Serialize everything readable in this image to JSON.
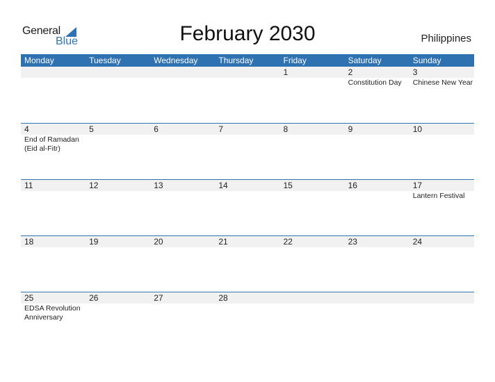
{
  "logo": {
    "word1": "General",
    "word2": "Blue"
  },
  "title": "February 2030",
  "country": "Philippines",
  "colors": {
    "header": "#2e72b2",
    "brand": "#2e74b5",
    "band": "#f1f1f1"
  },
  "weekdays": [
    "Monday",
    "Tuesday",
    "Wednesday",
    "Thursday",
    "Friday",
    "Saturday",
    "Sunday"
  ],
  "weeks": [
    [
      {
        "day": "",
        "event": ""
      },
      {
        "day": "",
        "event": ""
      },
      {
        "day": "",
        "event": ""
      },
      {
        "day": "",
        "event": ""
      },
      {
        "day": "1",
        "event": ""
      },
      {
        "day": "2",
        "event": "Constitution Day"
      },
      {
        "day": "3",
        "event": "Chinese New Year"
      }
    ],
    [
      {
        "day": "4",
        "event": "End of Ramadan (Eid al-Fitr)"
      },
      {
        "day": "5",
        "event": ""
      },
      {
        "day": "6",
        "event": ""
      },
      {
        "day": "7",
        "event": ""
      },
      {
        "day": "8",
        "event": ""
      },
      {
        "day": "9",
        "event": ""
      },
      {
        "day": "10",
        "event": ""
      }
    ],
    [
      {
        "day": "11",
        "event": ""
      },
      {
        "day": "12",
        "event": ""
      },
      {
        "day": "13",
        "event": ""
      },
      {
        "day": "14",
        "event": ""
      },
      {
        "day": "15",
        "event": ""
      },
      {
        "day": "16",
        "event": ""
      },
      {
        "day": "17",
        "event": "Lantern Festival"
      }
    ],
    [
      {
        "day": "18",
        "event": ""
      },
      {
        "day": "19",
        "event": ""
      },
      {
        "day": "20",
        "event": ""
      },
      {
        "day": "21",
        "event": ""
      },
      {
        "day": "22",
        "event": ""
      },
      {
        "day": "23",
        "event": ""
      },
      {
        "day": "24",
        "event": ""
      }
    ],
    [
      {
        "day": "25",
        "event": "EDSA Revolution Anniversary"
      },
      {
        "day": "26",
        "event": ""
      },
      {
        "day": "27",
        "event": ""
      },
      {
        "day": "28",
        "event": ""
      },
      {
        "day": "",
        "event": ""
      },
      {
        "day": "",
        "event": ""
      },
      {
        "day": "",
        "event": ""
      }
    ]
  ]
}
